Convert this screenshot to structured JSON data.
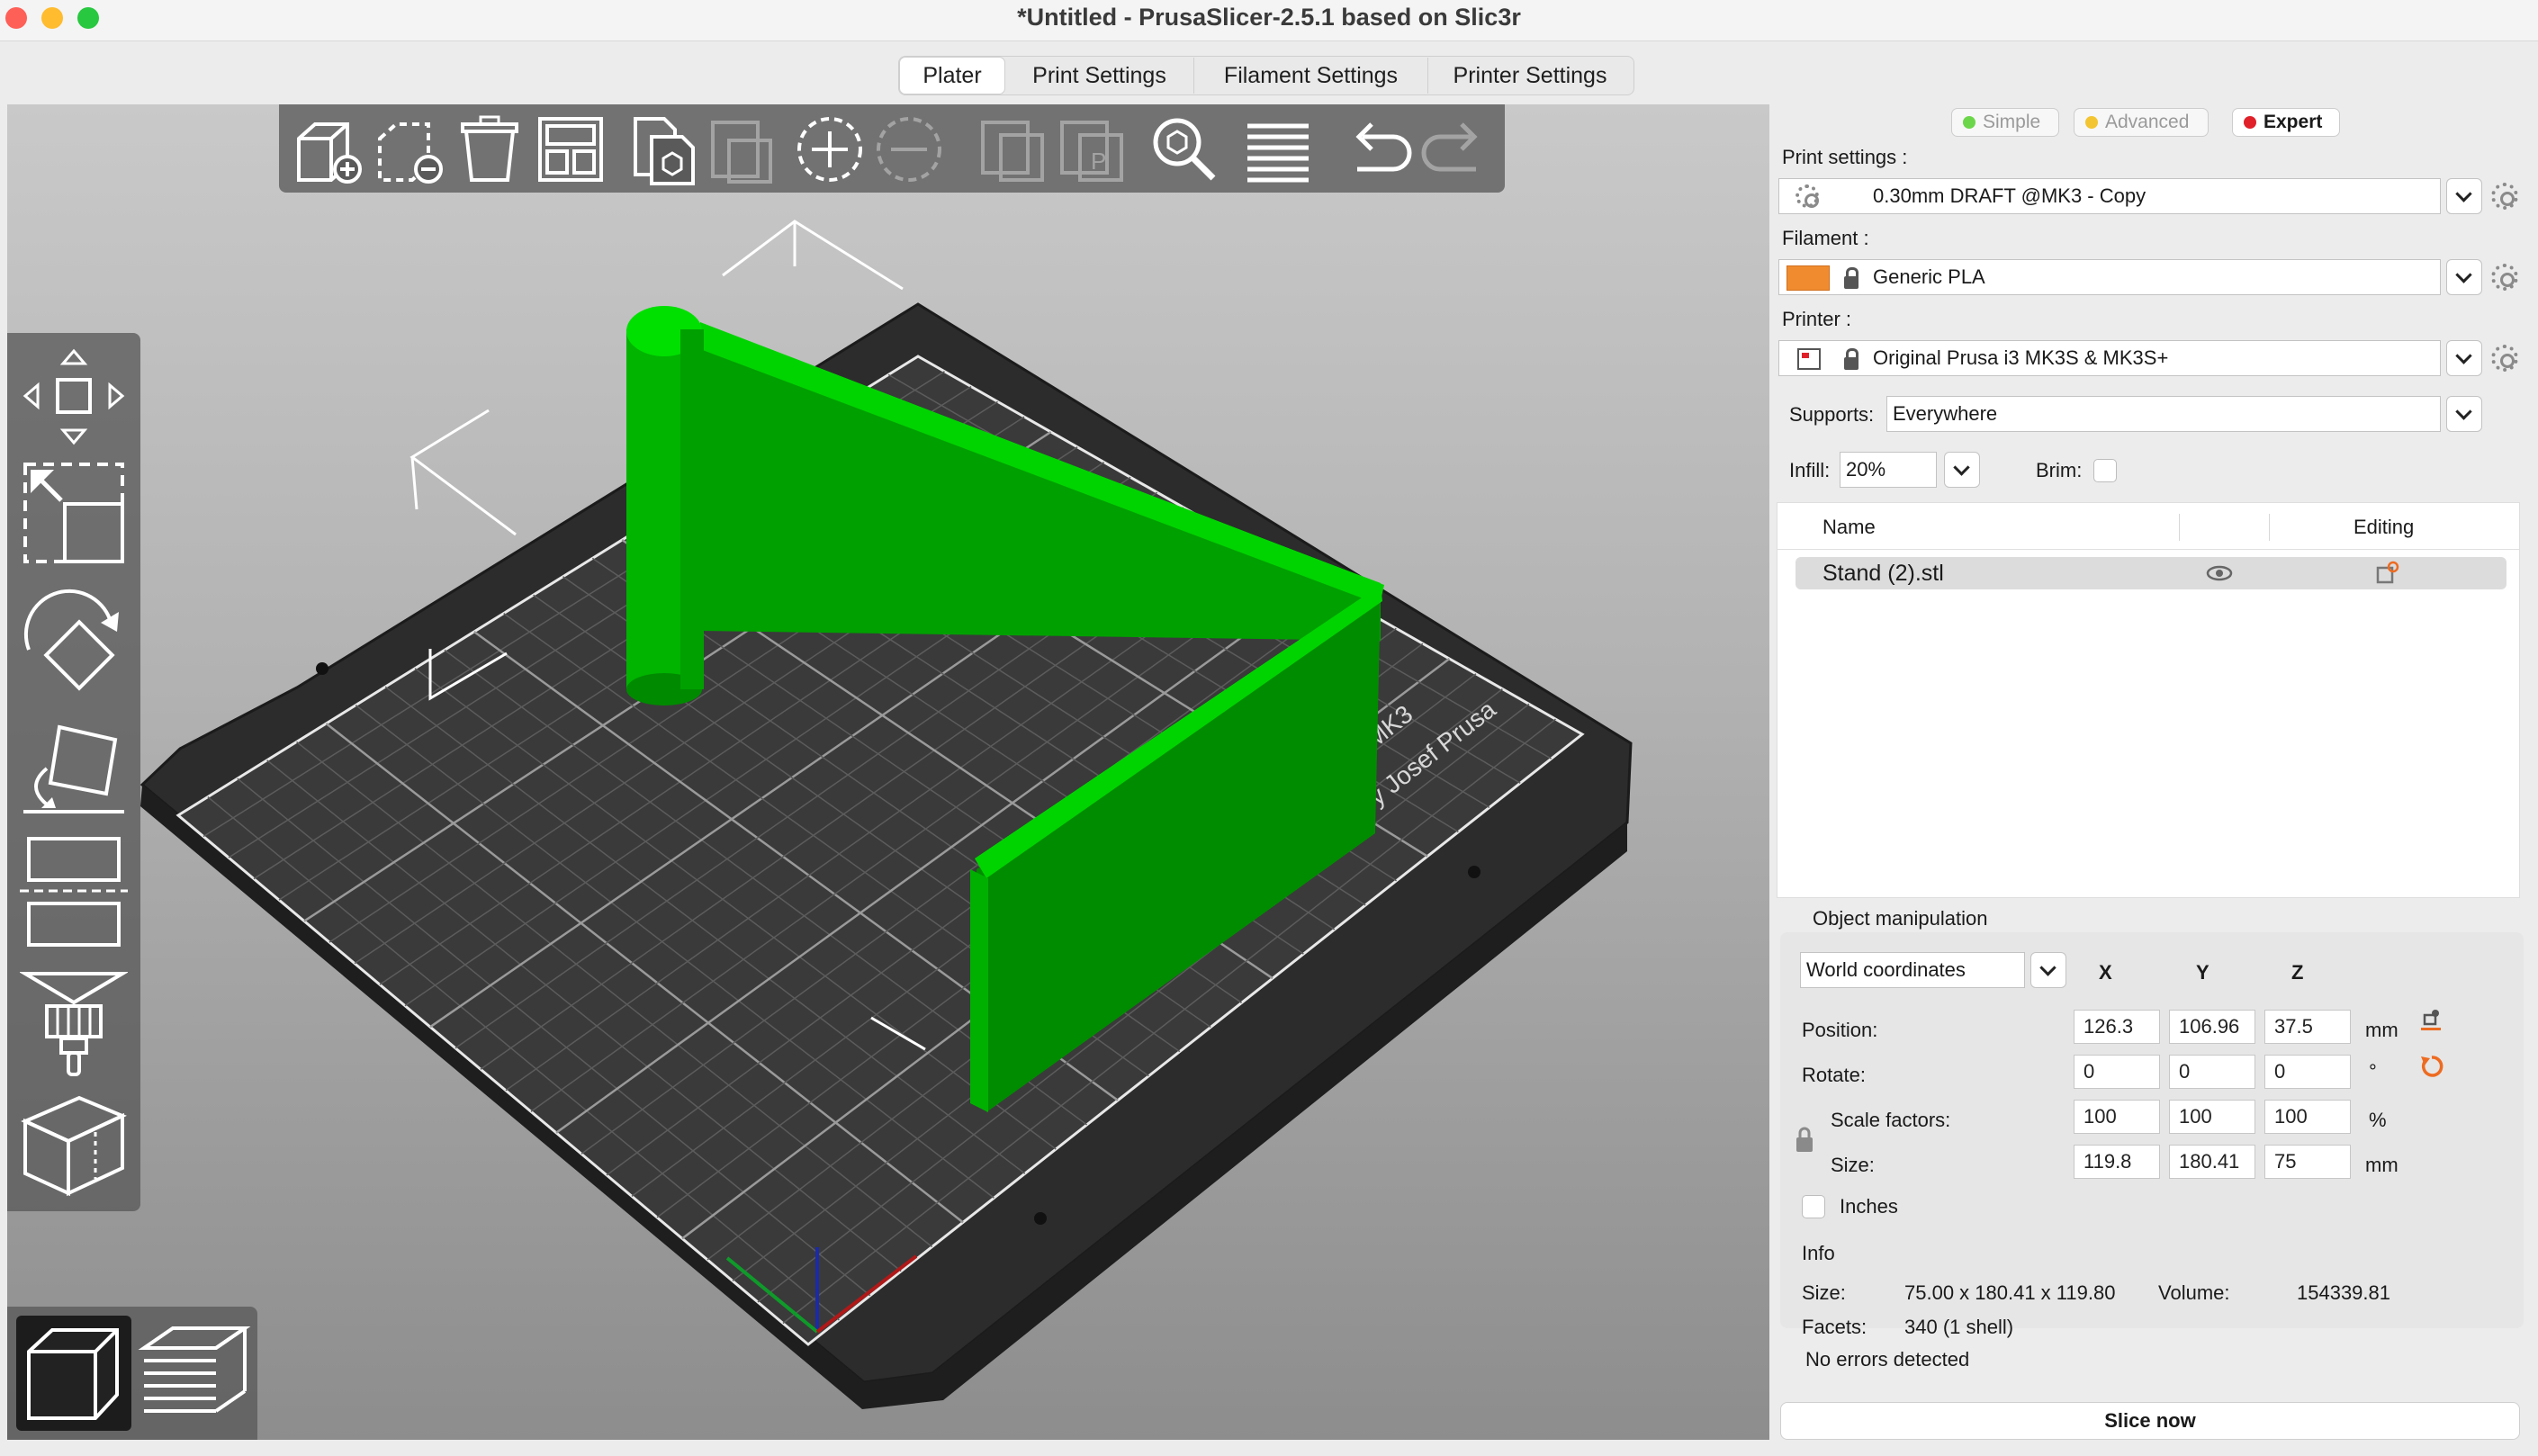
{
  "window": {
    "title": "*Untitled - PrusaSlicer-2.5.1 based on Slic3r"
  },
  "tabs": [
    {
      "label": "Plater",
      "active": true
    },
    {
      "label": "Print Settings",
      "active": false
    },
    {
      "label": "Filament Settings",
      "active": false
    },
    {
      "label": "Printer Settings",
      "active": false
    }
  ],
  "toolbar": {
    "icons": [
      "add-object-icon",
      "delete-icon",
      "delete-all-icon",
      "arrange-icon",
      "copy-icon",
      "paste-icon",
      "add-instance-icon",
      "remove-instance-icon",
      "split-objects-icon",
      "split-parts-icon",
      "search-icon",
      "layers-editing-icon",
      "undo-icon",
      "redo-icon"
    ]
  },
  "left_toolbar": {
    "icons": [
      "move-icon",
      "scale-icon",
      "rotate-icon",
      "place-on-face-icon",
      "cut-icon",
      "paint-supports-icon",
      "seam-painting-icon"
    ]
  },
  "bed": {
    "label_line1": "i3 MK3",
    "label_line2": "by Josef Prusa"
  },
  "view_selector": {
    "icons": [
      "3d-view-icon",
      "preview-layers-icon"
    ]
  },
  "mode": {
    "simple": "Simple",
    "advanced": "Advanced",
    "expert": "Expert",
    "colors": {
      "simple": "#6cd64a",
      "advanced": "#f3c532",
      "expert": "#e0212a"
    }
  },
  "presets": {
    "print_label": "Print settings :",
    "print_value": "0.30mm DRAFT @MK3 - Copy",
    "filament_label": "Filament :",
    "filament_value": "Generic PLA",
    "filament_color": "#f08b2f",
    "printer_label": "Printer :",
    "printer_value": "Original Prusa i3 MK3S & MK3S+",
    "supports_label": "Supports:",
    "supports_value": "Everywhere",
    "infill_label": "Infill:",
    "infill_value": "20%",
    "brim_label": "Brim:"
  },
  "object_list": {
    "col_name": "Name",
    "col_editing": "Editing",
    "rows": [
      {
        "name": "Stand (2).stl"
      }
    ]
  },
  "manipulation": {
    "title": "Object manipulation",
    "coords": "World coordinates",
    "axis_x": "X",
    "axis_y": "Y",
    "axis_z": "Z",
    "position_label": "Position:",
    "position": [
      "126.3",
      "106.96",
      "37.5"
    ],
    "position_unit": "mm",
    "rotate_label": "Rotate:",
    "rotate": [
      "0",
      "0",
      "0"
    ],
    "rotate_unit": "°",
    "scale_label": "Scale factors:",
    "scale": [
      "100",
      "100",
      "100"
    ],
    "scale_unit": "%",
    "size_label": "Size:",
    "size": [
      "119.8",
      "180.41",
      "75"
    ],
    "size_unit": "mm",
    "inches_label": "Inches"
  },
  "info": {
    "title": "Info",
    "size_label": "Size:",
    "size_value": "75.00 x 180.41 x 119.80",
    "volume_label": "Volume:",
    "volume_value": "154339.81",
    "facets_label": "Facets:",
    "facets_value": "340 (1 shell)",
    "errors": "No errors detected"
  },
  "slice_button": "Slice now",
  "colors": {
    "model": "#00c800",
    "model_dark": "#008a00",
    "bed": "#2d2d2d",
    "accent_orange": "#ed6b21"
  }
}
